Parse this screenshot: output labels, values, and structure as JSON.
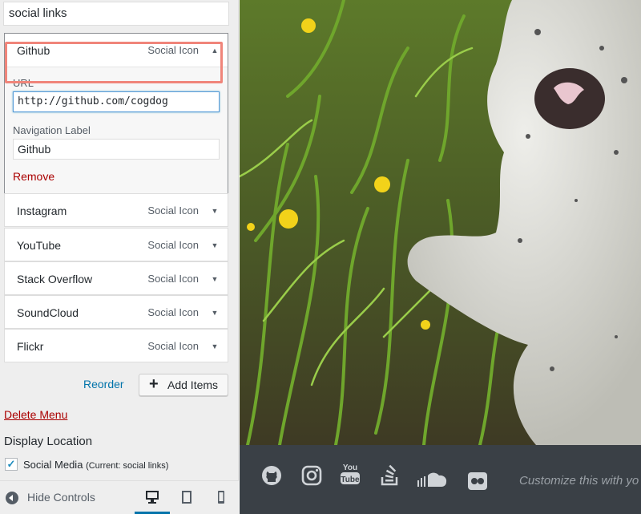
{
  "menu": {
    "name": "social links"
  },
  "github": {
    "title": "Github",
    "type": "Social Icon",
    "url_label": "URL",
    "url_value": "http://github.com/cogdog",
    "nav_label": "Navigation Label",
    "nav_value": "Github",
    "remove": "Remove"
  },
  "items": [
    {
      "title": "Instagram",
      "type": "Social Icon"
    },
    {
      "title": "YouTube",
      "type": "Social Icon"
    },
    {
      "title": "Stack Overflow",
      "type": "Social Icon"
    },
    {
      "title": "SoundCloud",
      "type": "Social Icon"
    },
    {
      "title": "Flickr",
      "type": "Social Icon"
    }
  ],
  "actions": {
    "reorder": "Reorder",
    "add_items": "Add Items"
  },
  "delete_menu": "Delete Menu",
  "display_location": {
    "heading": "Display Location",
    "checked": true,
    "label": "Social Media",
    "current": "(Current: social links)"
  },
  "footer": {
    "hide_controls": "Hide Controls",
    "active_device": "desktop"
  },
  "preview": {
    "customize_text": "Customize this with yo",
    "social_icons": [
      "github-icon",
      "instagram-icon",
      "youtube-icon",
      "stackoverflow-icon",
      "soundcloud-icon",
      "flickr-icon"
    ]
  },
  "colors": {
    "link_blue": "#0073aa",
    "delete_red": "#aa0000",
    "highlight": "#f0857a",
    "footer_bg": "#3a4046"
  }
}
